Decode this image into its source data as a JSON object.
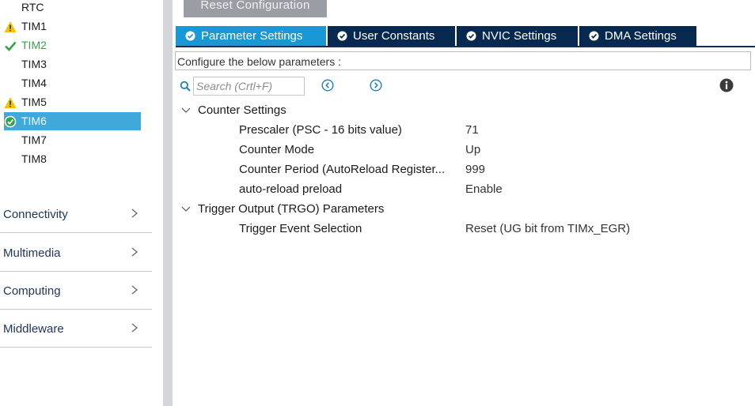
{
  "sidebar": {
    "peripherals": [
      {
        "label": "RTC",
        "status": "none"
      },
      {
        "label": "TIM1",
        "status": "warning"
      },
      {
        "label": "TIM2",
        "status": "ok"
      },
      {
        "label": "TIM3",
        "status": "none"
      },
      {
        "label": "TIM4",
        "status": "none"
      },
      {
        "label": "TIM5",
        "status": "warning"
      },
      {
        "label": "TIM6",
        "status": "selected"
      },
      {
        "label": "TIM7",
        "status": "none"
      },
      {
        "label": "TIM8",
        "status": "none"
      }
    ],
    "categories": [
      {
        "label": "Connectivity"
      },
      {
        "label": "Multimedia"
      },
      {
        "label": "Computing"
      },
      {
        "label": "Middleware"
      }
    ]
  },
  "toolbar": {
    "reset_label": "Reset Configuration"
  },
  "tabs": [
    {
      "label": "Parameter Settings",
      "active": true
    },
    {
      "label": "User Constants",
      "active": false
    },
    {
      "label": "NVIC Settings",
      "active": false
    },
    {
      "label": "DMA Settings",
      "active": false
    }
  ],
  "configure_text": "Configure the below parameters :",
  "search": {
    "placeholder": "Search (Crtl+F)",
    "value": ""
  },
  "groups": [
    {
      "title": "Counter Settings",
      "params": [
        {
          "name": "Prescaler (PSC - 16 bits value)",
          "value": "71"
        },
        {
          "name": "Counter Mode",
          "value": "Up"
        },
        {
          "name": "Counter Period (AutoReload Register...",
          "value": "999"
        },
        {
          "name": "auto-reload preload",
          "value": "Enable"
        }
      ]
    },
    {
      "title": "Trigger Output (TRGO) Parameters",
      "params": [
        {
          "name": "Trigger Event Selection",
          "value": "Reset (UG bit from TIMx_EGR)"
        }
      ]
    }
  ],
  "colors": {
    "warning": "#f2c200",
    "ok": "#2fa642",
    "selected": "#3ea9da",
    "tab_active": "#1a98d6",
    "tab_inactive": "#07294f"
  },
  "icons": {
    "warning": "warning-icon",
    "ok": "check-icon",
    "selected": "check-circle-icon",
    "search": "search-icon",
    "prev": "chevron-left-circle-icon",
    "next": "chevron-right-circle-icon",
    "info": "info-icon"
  }
}
